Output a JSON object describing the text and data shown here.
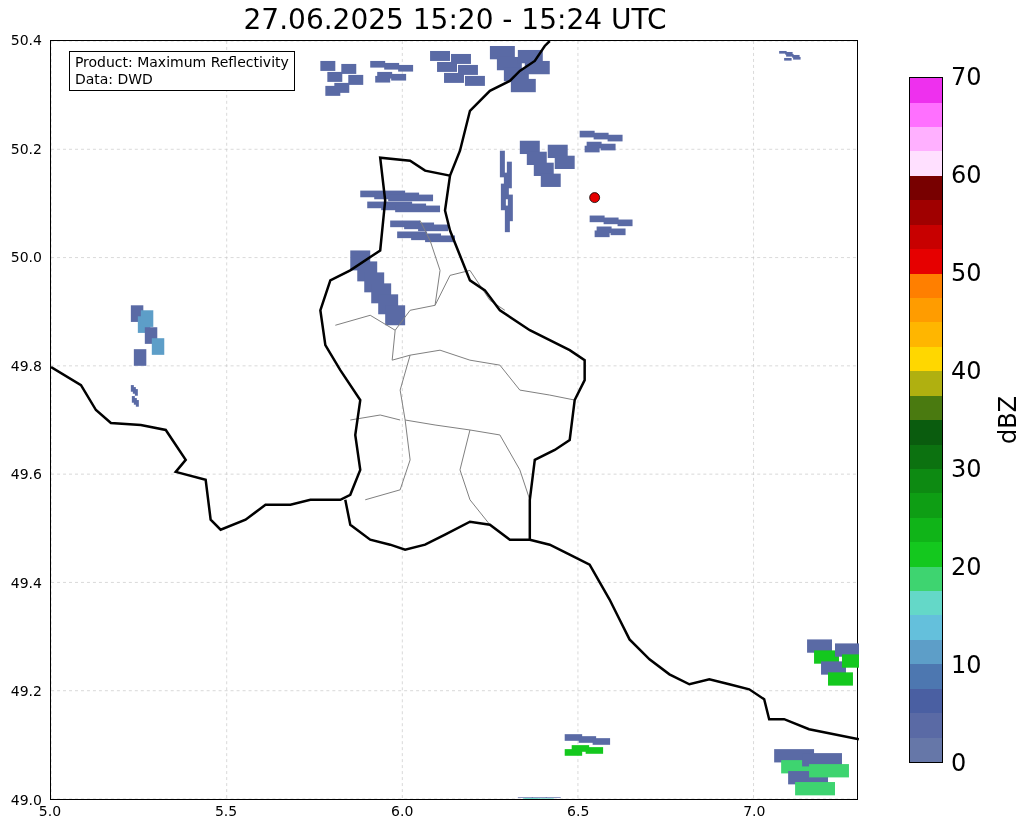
{
  "title": "27.06.2025 15:20 - 15:24 UTC",
  "legend": [
    "Product: Maximum Reflectivity",
    "Data: DWD"
  ],
  "y_ticks": [
    "50.4",
    "50.2",
    "50.0",
    "49.8",
    "49.6",
    "49.4",
    "49.2",
    "49.0"
  ],
  "x_ticks": [
    "5.0",
    "5.5",
    "6.0",
    "6.5",
    "7.0"
  ],
  "colorbar": {
    "label": "dBZ",
    "ticks": [
      "70",
      "60",
      "50",
      "40",
      "30",
      "20",
      "10",
      "0"
    ],
    "bins": [
      {
        "color": "#6677a8"
      },
      {
        "color": "#5a6aa5"
      },
      {
        "color": "#4a5fa2"
      },
      {
        "color": "#4d77b0"
      },
      {
        "color": "#5d9ec8"
      },
      {
        "color": "#64c0dc"
      },
      {
        "color": "#64d8c8"
      },
      {
        "color": "#3ed470"
      },
      {
        "color": "#14c81e"
      },
      {
        "color": "#10b418"
      },
      {
        "color": "#0e9e14"
      },
      {
        "color": "#0d8a12"
      },
      {
        "color": "#0c7210"
      },
      {
        "color": "#0a5c0e"
      },
      {
        "color": "#4a7a10"
      },
      {
        "color": "#b0b010"
      },
      {
        "color": "#ffd700"
      },
      {
        "color": "#ffb600"
      },
      {
        "color": "#ff9c00"
      },
      {
        "color": "#ff7f00"
      },
      {
        "color": "#e60000"
      },
      {
        "color": "#c80000"
      },
      {
        "color": "#a00000"
      },
      {
        "color": "#780000"
      },
      {
        "color": "#ffe0ff"
      },
      {
        "color": "#ffb0ff"
      },
      {
        "color": "#ff70ff"
      },
      {
        "color": "#ee30ee"
      }
    ]
  }
}
